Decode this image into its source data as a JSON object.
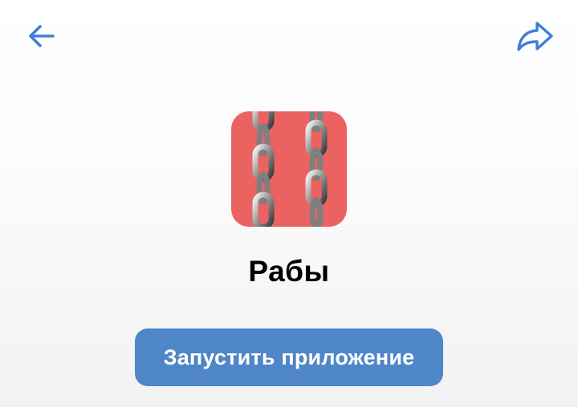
{
  "header": {
    "back_icon": "arrow-left-icon",
    "share_icon": "share-arrow-icon",
    "accent_color": "#3f7fd6"
  },
  "app": {
    "title": "Рабы",
    "icon": "chains-icon",
    "icon_background": "#ea6361"
  },
  "actions": {
    "launch_label": "Запустить приложение",
    "launch_color": "#4f86c8"
  }
}
